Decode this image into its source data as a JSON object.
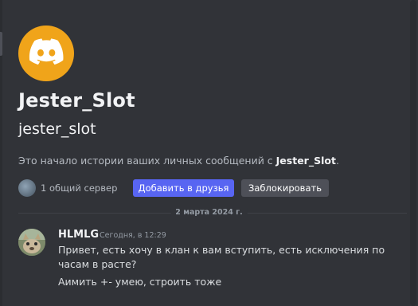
{
  "profile": {
    "display_name": "Jester_Slot",
    "username": "jester_slot",
    "avatar_icon": "discord-logo-icon",
    "avatar_color": "#f0a41a"
  },
  "history_note": {
    "prefix": "Это начало истории ваших личных сообщений с ",
    "name": "Jester_Slot",
    "suffix": "."
  },
  "mutual": {
    "label": "1 общий сервер"
  },
  "actions": {
    "add_friend": "Добавить в друзья",
    "block": "Заблокировать"
  },
  "date_divider": "2 марта 2024 г.",
  "message": {
    "author": "HLMLG",
    "timestamp": "Сегодня, в 12:29",
    "lines": [
      "Привет, есть хочу в клан к вам вступить, есть исключения по часам в расте?",
      "Аимить +- умею, строить тоже"
    ]
  },
  "colors": {
    "background": "#313338",
    "accent": "#5865f2",
    "secondary_button": "#4e5058"
  }
}
